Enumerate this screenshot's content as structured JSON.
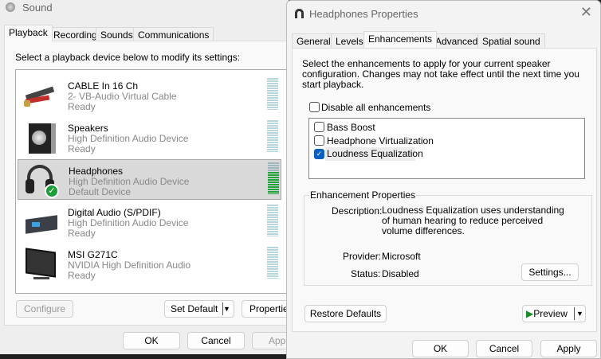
{
  "sound": {
    "title": "Sound",
    "tabs": [
      "Playback",
      "Recording",
      "Sounds",
      "Communications"
    ],
    "instruction": "Select a playback device below to modify its settings:",
    "devices": [
      {
        "name": "CABLE In 16 Ch",
        "desc": "2- VB-Audio Virtual Cable",
        "status": "Ready"
      },
      {
        "name": "Speakers",
        "desc": "High Definition Audio Device",
        "status": "Ready"
      },
      {
        "name": "Headphones",
        "desc": "High Definition Audio Device",
        "status": "Default Device"
      },
      {
        "name": "Digital Audio (S/PDIF)",
        "desc": "High Definition Audio Device",
        "status": "Ready"
      },
      {
        "name": "MSI G271C",
        "desc": "NVIDIA High Definition Audio",
        "status": "Ready"
      }
    ],
    "configure": "Configure",
    "set_default": "Set Default",
    "properties": "Properties",
    "ok": "OK",
    "cancel": "Cancel",
    "apply": "Apply"
  },
  "props": {
    "title": "Headphones Properties",
    "tabs": [
      "General",
      "Levels",
      "Enhancements",
      "Advanced",
      "Spatial sound"
    ],
    "intro": "Select the enhancements to apply for your current speaker configuration. Changes may not take effect until the next time you start playback.",
    "disable_all": "Disable all enhancements",
    "enhancements": [
      {
        "label": "Bass Boost",
        "checked": false
      },
      {
        "label": "Headphone Virtualization",
        "checked": false
      },
      {
        "label": "Loudness Equalization",
        "checked": true
      }
    ],
    "group_title": "Enhancement Properties",
    "description_label": "Description:",
    "description": "Loudness Equalization uses understanding of human hearing to reduce perceived volume differences.",
    "provider_label": "Provider:",
    "provider": "Microsoft",
    "status_label": "Status:",
    "status": "Disabled",
    "settings": "Settings...",
    "restore": "Restore Defaults",
    "preview": "Preview",
    "ok": "OK",
    "cancel": "Cancel",
    "apply": "Apply"
  },
  "colors": {
    "accent": "#0a5fc0",
    "meter_active": "#22a23a",
    "meter_idle": "#b7d5dc"
  }
}
